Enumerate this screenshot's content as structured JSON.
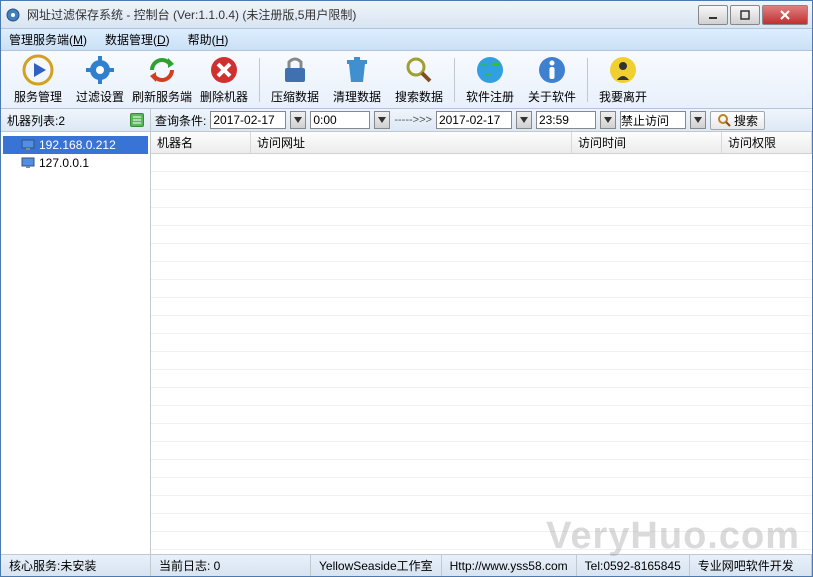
{
  "title": "网址过滤保存系统 - 控制台 (Ver:1.1.0.4) (未注册版,5用户限制)",
  "menu": {
    "m1": "管理服务端(",
    "m1u": "M",
    "m1e": ")",
    "m2": "数据管理(",
    "m2u": "D",
    "m2e": ")",
    "m3": "帮助(",
    "m3u": "H",
    "m3e": ")"
  },
  "toolbar": {
    "service_mgmt": "服务管理",
    "filter_settings": "过滤设置",
    "refresh_server": "刷新服务端",
    "delete_machine": "删除机器",
    "compress_data": "压缩数据",
    "clean_data": "清理数据",
    "search_data": "搜索数据",
    "software_reg": "软件注册",
    "about": "关于软件",
    "exit": "我要离开"
  },
  "sidebar": {
    "header": "机器列表:2",
    "items": [
      {
        "ip": "192.168.0.212",
        "selected": true
      },
      {
        "ip": "127.0.0.1",
        "selected": false
      }
    ]
  },
  "filter": {
    "label": "查询条件:",
    "date_from": "2017-02-17",
    "time_from": "0:00",
    "arrow": "----->>>",
    "date_to": "2017-02-17",
    "time_to": "23:59",
    "access": "禁止访问",
    "search": "搜索"
  },
  "table": {
    "columns": [
      "机器名",
      "访问网址",
      "访问时间",
      "访问权限"
    ]
  },
  "status": {
    "core_service": "核心服务:未安装",
    "log": "当前日志: 0",
    "studio": "YellowSeaside工作室",
    "url": "Http://www.yss58.com",
    "tel": "Tel:0592-8165845",
    "tagline": "专业网吧软件开发"
  },
  "watermark": "VeryHuo.com"
}
